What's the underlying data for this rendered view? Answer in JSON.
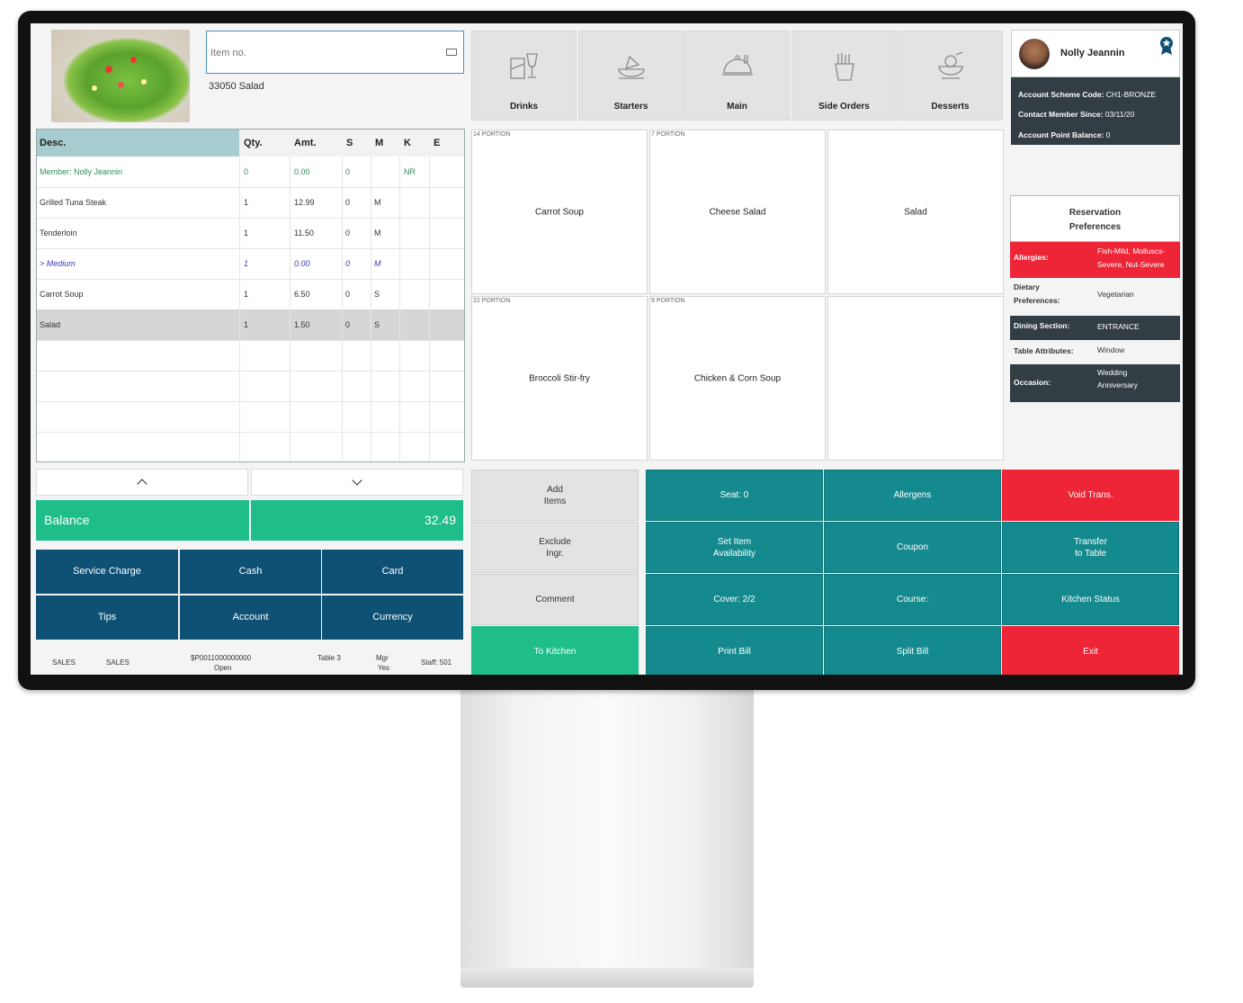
{
  "search": {
    "placeholder": "Item no."
  },
  "selected_item": {
    "label": "33050 Salad"
  },
  "order_table": {
    "headers": [
      "Desc.",
      "Qty.",
      "Amt.",
      "S",
      "M",
      "K",
      "E"
    ],
    "rows": [
      {
        "desc": "Member: Nolly Jeannin",
        "qty": "0",
        "amt": "0.00",
        "s": "0",
        "m": "",
        "k": "NR",
        "e": ""
      },
      {
        "desc": "Grilled Tuna Steak",
        "qty": "1",
        "amt": "12.99",
        "s": "0",
        "m": "M",
        "k": "",
        "e": ""
      },
      {
        "desc": "Tenderloin",
        "qty": "1",
        "amt": "11.50",
        "s": "0",
        "m": "M",
        "k": "",
        "e": ""
      },
      {
        "desc": "> Medium",
        "qty": "1",
        "amt": "0.00",
        "s": "0",
        "m": "M",
        "k": "",
        "e": ""
      },
      {
        "desc": "Carrot Soup",
        "qty": "1",
        "amt": "6.50",
        "s": "0",
        "m": "S",
        "k": "",
        "e": ""
      },
      {
        "desc": "Salad",
        "qty": "1",
        "amt": "1.50",
        "s": "0",
        "m": "S",
        "k": "",
        "e": ""
      }
    ]
  },
  "balance": {
    "label": "Balance",
    "value": "32.49"
  },
  "payment_buttons": [
    "Service Charge",
    "Cash",
    "Card",
    "Tips",
    "Account",
    "Currency"
  ],
  "status_bar": {
    "mode1": "SALES",
    "mode2": "SALES",
    "order_no": "$P0011000000000",
    "order_state": "Open",
    "table": "Table 3",
    "mgr_label": "Mgr",
    "mgr_value": "Yes",
    "staff": "Staff: 501"
  },
  "categories": [
    {
      "label": "Drinks",
      "icon": "drinks-icon"
    },
    {
      "label": "Starters",
      "icon": "starters-icon"
    },
    {
      "label": "Main",
      "icon": "main-course-icon"
    },
    {
      "label": "Side Orders",
      "icon": "fries-icon"
    },
    {
      "label": "Desserts",
      "icon": "dessert-icon"
    }
  ],
  "products": [
    {
      "name": "Carrot Soup",
      "portion": "14 PORTION"
    },
    {
      "name": "Cheese Salad",
      "portion": "7 PORTION"
    },
    {
      "name": "Salad",
      "portion": ""
    },
    {
      "name": "Broccoli Stir-fry",
      "portion": "22 PORTION"
    },
    {
      "name": "Chicken & Corn Soup",
      "portion": "9 PORTION"
    },
    {
      "name": "",
      "portion": ""
    }
  ],
  "actions": {
    "add_items_1": "Add",
    "add_items_2": "Items",
    "exclude_1": "Exclude",
    "exclude_2": "Ingr.",
    "comment": "Comment",
    "to_kitchen": "To Kitchen",
    "seat": "Seat: 0",
    "allergens": "Allergens",
    "void": "Void Trans.",
    "set_avail_1": "Set Item",
    "set_avail_2": "Availability",
    "coupon": "Coupon",
    "transfer_1": "Transfer",
    "transfer_2": "to Table",
    "cover": "Cover: 2/2",
    "course": "Course:",
    "kitchen_status": "Kitchen Status",
    "print_bill": "Print Bill",
    "split_bill": "Split Bill",
    "exit": "Exit"
  },
  "member": {
    "name": "Nolly Jeannin",
    "scheme_label": "Account Scheme Code:",
    "scheme_value": "CH1-BRONZE",
    "since_label": "Contact Member Since:",
    "since_value": "03/11/20",
    "points_label": "Account Point Balance:",
    "points_value": "0"
  },
  "reservation": {
    "title_1": "Reservation",
    "title_2": "Preferences",
    "allergies_label": "Allergies:",
    "allergies_1": "Fish-Mild, Molluscs-",
    "allergies_2": "Severe, Nut-Severe",
    "dietary_label_1": "Dietary",
    "dietary_label_2": "Preferences:",
    "dietary_value": "Vegetarian",
    "section_label": "Dining Section:",
    "section_value": "ENTRANCE",
    "table_attr_label": "Table Attributes:",
    "table_attr_value": "Window",
    "occasion_label": "Occasion:",
    "occasion_1": "Wedding",
    "occasion_2": "Anniversary"
  },
  "colors": {
    "teal": "#158a8e",
    "red": "#ee2437",
    "green": "#1fbd89",
    "navy": "#0e5175",
    "dark": "#323d44"
  }
}
